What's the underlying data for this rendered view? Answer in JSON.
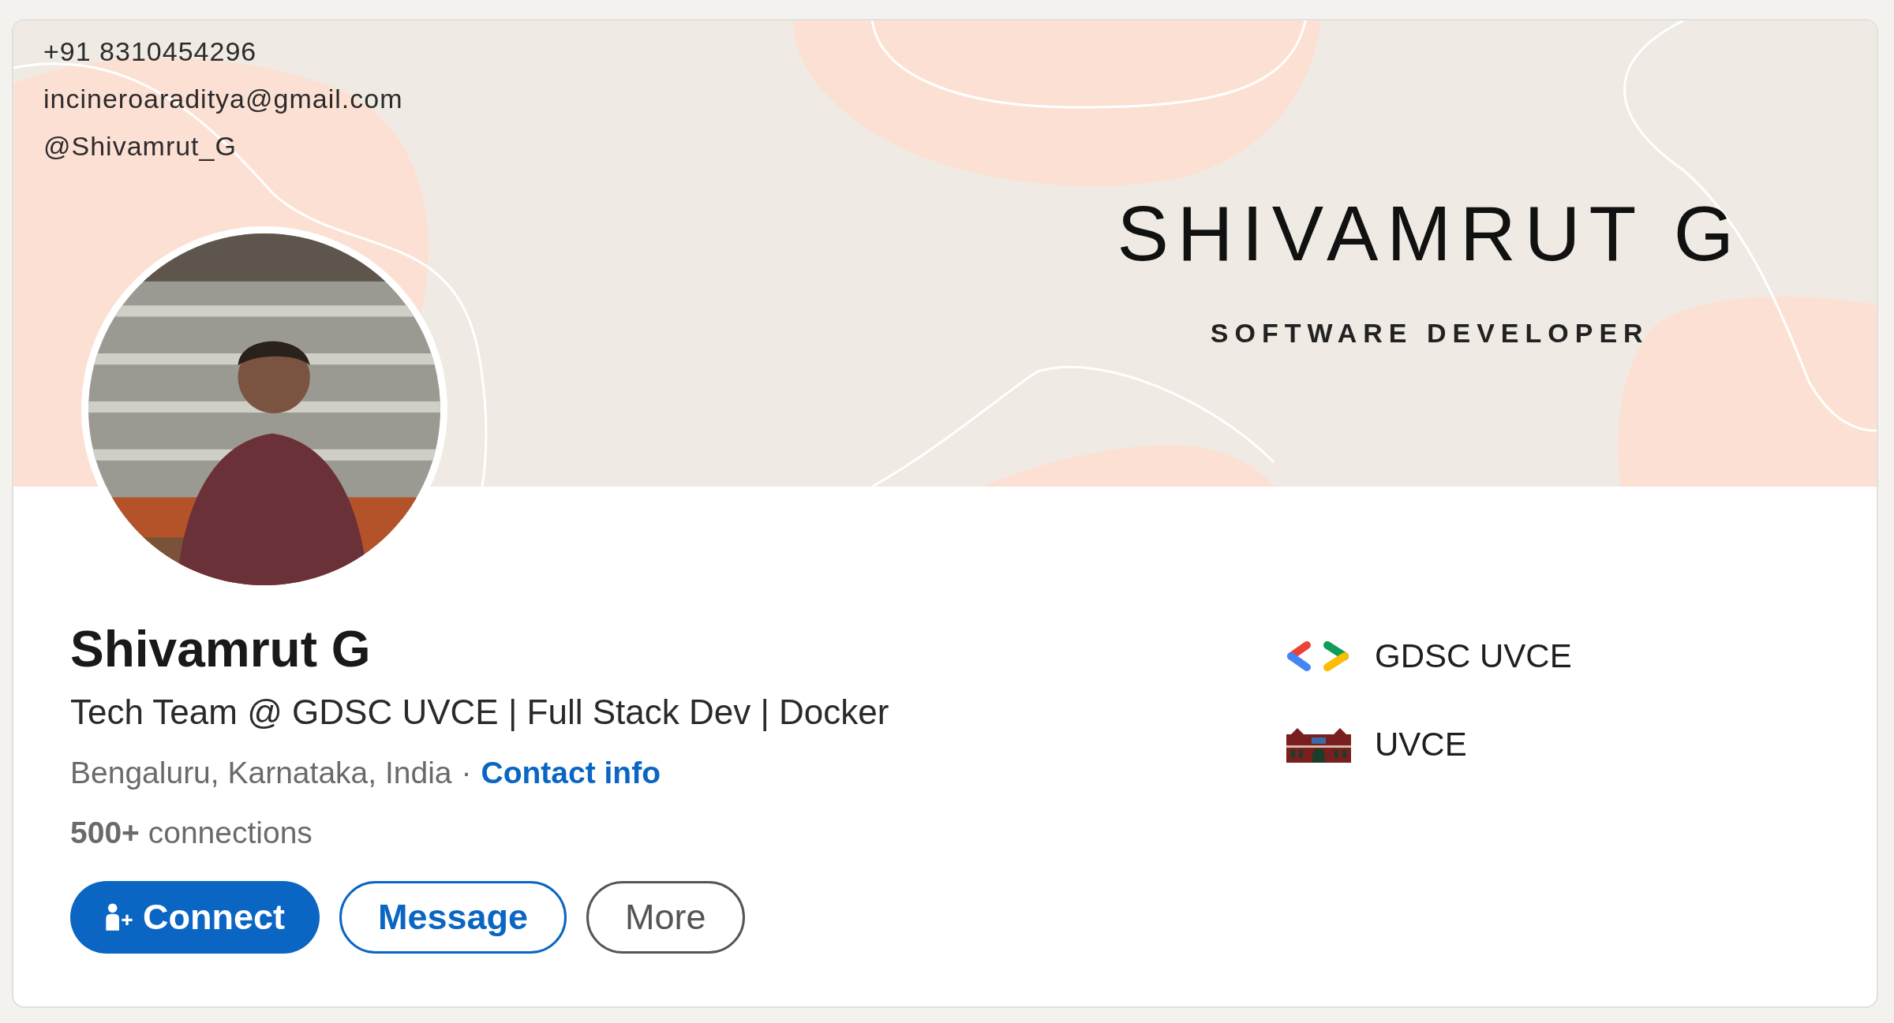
{
  "banner": {
    "contact_lines": [
      "+91 8310454296",
      "incineroaraditya@gmail.com",
      "@Shivamrut_G"
    ],
    "title": "SHIVAMRUT G",
    "subtitle": "SOFTWARE DEVELOPER"
  },
  "profile": {
    "name": "Shivamrut G",
    "headline": "Tech Team @ GDSC UVCE | Full Stack Dev | Docker",
    "location": "Bengaluru, Karnataka, India",
    "separator": "·",
    "contact_link": "Contact info",
    "connections": "**500+** connections"
  },
  "actions": [
    {
      "label": "Connect",
      "kind": "primary"
    },
    {
      "label": "Message",
      "kind": "secondary"
    },
    {
      "label": "More",
      "kind": "tertiary"
    }
  ],
  "organizations": [
    {
      "name": "GDSC UVCE",
      "kind": "community"
    },
    {
      "name": "UVCE",
      "kind": "college"
    }
  ]
}
